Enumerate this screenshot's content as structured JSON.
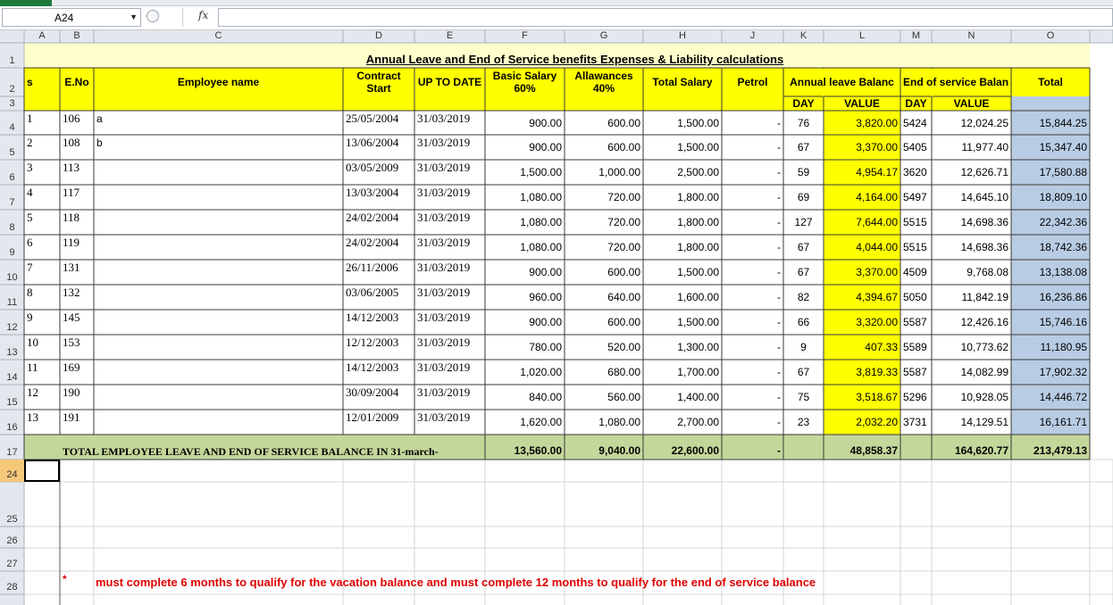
{
  "formula_bar": {
    "name_box": "A24",
    "fx_label": "fx",
    "formula": ""
  },
  "columns": [
    "A",
    "B",
    "C",
    "D",
    "E",
    "F",
    "G",
    "H",
    "J",
    "K",
    "L",
    "M",
    "N",
    "O"
  ],
  "row_numbers": [
    "1",
    "2",
    "3",
    "4",
    "5",
    "6",
    "7",
    "8",
    "9",
    "10",
    "11",
    "12",
    "13",
    "14",
    "15",
    "16",
    "17",
    "24",
    "25",
    "26",
    "27",
    "28",
    "29"
  ],
  "sheet": {
    "title": "Annual Leave and End of Service benefits Expenses & Liability calculations",
    "headers": {
      "s": "s",
      "eno": "E.No",
      "name": "Employee name",
      "contract_line1": "Contract",
      "contract_line2": "Start",
      "up_to_date": "UP TO DATE",
      "basic_line1": "Basic Salary",
      "basic_line2": "60%",
      "allow_line1": "Allawances",
      "allow_line2": "40%",
      "total_salary": "Total Salary",
      "petrol": "Petrol",
      "annual_leave": "Annual leave Balanc",
      "end_service": "End of service Balanc",
      "total": "Total",
      "day1": "DAY",
      "value1": "VALUE",
      "day2": "DAY",
      "value2": "VALUE"
    },
    "rows": [
      {
        "s": "1",
        "eno": "106",
        "name": "a",
        "contract": "25/05/2004",
        "upto": "31/03/2019",
        "basic": "900.00",
        "allow": "600.00",
        "total_salary": "1,500.00",
        "petrol": "-",
        "al_day": "76",
        "al_value": "3,820.00",
        "eos_day": "5424",
        "eos_value": "12,024.25",
        "total": "15,844.25"
      },
      {
        "s": "2",
        "eno": "108",
        "name": "b",
        "contract": "13/06/2004",
        "upto": "31/03/2019",
        "basic": "900.00",
        "allow": "600.00",
        "total_salary": "1,500.00",
        "petrol": "-",
        "al_day": "67",
        "al_value": "3,370.00",
        "eos_day": "5405",
        "eos_value": "11,977.40",
        "total": "15,347.40"
      },
      {
        "s": "3",
        "eno": "113",
        "name": "",
        "contract": "03/05/2009",
        "upto": "31/03/2019",
        "basic": "1,500.00",
        "allow": "1,000.00",
        "total_salary": "2,500.00",
        "petrol": "-",
        "al_day": "59",
        "al_value": "4,954.17",
        "eos_day": "3620",
        "eos_value": "12,626.71",
        "total": "17,580.88"
      },
      {
        "s": "4",
        "eno": "117",
        "name": "",
        "contract": "13/03/2004",
        "upto": "31/03/2019",
        "basic": "1,080.00",
        "allow": "720.00",
        "total_salary": "1,800.00",
        "petrol": "-",
        "al_day": "69",
        "al_value": "4,164.00",
        "eos_day": "5497",
        "eos_value": "14,645.10",
        "total": "18,809.10"
      },
      {
        "s": "5",
        "eno": "118",
        "name": "",
        "contract": "24/02/2004",
        "upto": "31/03/2019",
        "basic": "1,080.00",
        "allow": "720.00",
        "total_salary": "1,800.00",
        "petrol": "-",
        "al_day": "127",
        "al_value": "7,644.00",
        "eos_day": "5515",
        "eos_value": "14,698.36",
        "total": "22,342.36"
      },
      {
        "s": "6",
        "eno": "119",
        "name": "",
        "contract": "24/02/2004",
        "upto": "31/03/2019",
        "basic": "1,080.00",
        "allow": "720.00",
        "total_salary": "1,800.00",
        "petrol": "-",
        "al_day": "67",
        "al_value": "4,044.00",
        "eos_day": "5515",
        "eos_value": "14,698.36",
        "total": "18,742.36"
      },
      {
        "s": "7",
        "eno": "131",
        "name": "",
        "contract": "26/11/2006",
        "upto": "31/03/2019",
        "basic": "900.00",
        "allow": "600.00",
        "total_salary": "1,500.00",
        "petrol": "-",
        "al_day": "67",
        "al_value": "3,370.00",
        "eos_day": "4509",
        "eos_value": "9,768.08",
        "total": "13,138.08"
      },
      {
        "s": "8",
        "eno": "132",
        "name": "",
        "contract": "03/06/2005",
        "upto": "31/03/2019",
        "basic": "960.00",
        "allow": "640.00",
        "total_salary": "1,600.00",
        "petrol": "-",
        "al_day": "82",
        "al_value": "4,394.67",
        "eos_day": "5050",
        "eos_value": "11,842.19",
        "total": "16,236.86"
      },
      {
        "s": "9",
        "eno": "145",
        "name": "",
        "contract": "14/12/2003",
        "upto": "31/03/2019",
        "basic": "900.00",
        "allow": "600.00",
        "total_salary": "1,500.00",
        "petrol": "-",
        "al_day": "66",
        "al_value": "3,320.00",
        "eos_day": "5587",
        "eos_value": "12,426.16",
        "total": "15,746.16"
      },
      {
        "s": "10",
        "eno": "153",
        "name": "",
        "contract": "12/12/2003",
        "upto": "31/03/2019",
        "basic": "780.00",
        "allow": "520.00",
        "total_salary": "1,300.00",
        "petrol": "-",
        "al_day": "9",
        "al_value": "407.33",
        "eos_day": "5589",
        "eos_value": "10,773.62",
        "total": "11,180.95"
      },
      {
        "s": "11",
        "eno": "169",
        "name": "",
        "contract": "14/12/2003",
        "upto": "31/03/2019",
        "basic": "1,020.00",
        "allow": "680.00",
        "total_salary": "1,700.00",
        "petrol": "-",
        "al_day": "67",
        "al_value": "3,819.33",
        "eos_day": "5587",
        "eos_value": "14,082.99",
        "total": "17,902.32"
      },
      {
        "s": "12",
        "eno": "190",
        "name": "",
        "contract": "30/09/2004",
        "upto": "31/03/2019",
        "basic": "840.00",
        "allow": "560.00",
        "total_salary": "1,400.00",
        "petrol": "-",
        "al_day": "75",
        "al_value": "3,518.67",
        "eos_day": "5296",
        "eos_value": "10,928.05",
        "total": "14,446.72"
      },
      {
        "s": "13",
        "eno": "191",
        "name": "",
        "contract": "12/01/2009",
        "upto": "31/03/2019",
        "basic": "1,620.00",
        "allow": "1,080.00",
        "total_salary": "2,700.00",
        "petrol": "-",
        "al_day": "23",
        "al_value": "2,032.20",
        "eos_day": "3731",
        "eos_value": "14,129.51",
        "total": "16,161.71"
      }
    ],
    "totals": {
      "label": "TOTAL EMPLOYEE LEAVE AND END OF SERVICE  BALANCE IN  31-march-",
      "basic": "13,560.00",
      "allow": "9,040.00",
      "total_salary": "22,600.00",
      "petrol": "-",
      "al_value": "48,858.37",
      "eos_value": "164,620.77",
      "total": "213,479.13"
    },
    "note_star": "*",
    "note": "must complete 6 months to qualify for the vacation balance and must complete 12 months to qualify  for the end of service balance"
  },
  "colors": {
    "yellow": "#ffff00",
    "light_yellow": "#ffffcc",
    "green": "#c4d79b",
    "blue": "#b8cce4",
    "red_text": "#e00000"
  }
}
